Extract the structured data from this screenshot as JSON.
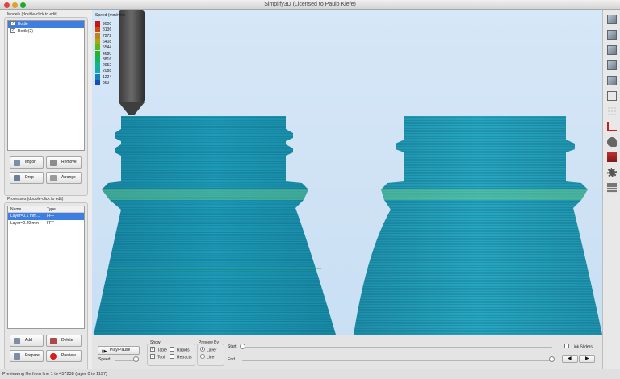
{
  "window": {
    "title": "Simplify3D (Licensed to Paulo Kiefe)"
  },
  "models": {
    "label": "Models (double-click to edit)",
    "items": [
      {
        "name": "Bottle",
        "checked": true,
        "selected": true
      },
      {
        "name": "Bottle(2)",
        "checked": true,
        "selected": false
      }
    ],
    "buttons": {
      "import": "Import",
      "remove": "Remove",
      "drop": "Drop",
      "arrange": "Arrange"
    }
  },
  "processes": {
    "label": "Processes (double-click to edit)",
    "columns": [
      "Name",
      "Type"
    ],
    "rows": [
      {
        "name": "Layer=0.1 mm...",
        "type": "FFF",
        "selected": true
      },
      {
        "name": "Layer=0.29 mm",
        "type": "FFF",
        "selected": false
      }
    ],
    "buttons": {
      "add": "Add",
      "delete": "Delete",
      "prepare": "Prepare",
      "preview": "Preview"
    }
  },
  "legend": {
    "title": "Speed (mm/min)",
    "entries": [
      {
        "value": "9000",
        "color": "#c81414"
      },
      {
        "value": "8136",
        "color": "#c84a14"
      },
      {
        "value": "7272",
        "color": "#c88214"
      },
      {
        "value": "6408",
        "color": "#a8a814"
      },
      {
        "value": "5544",
        "color": "#64b414"
      },
      {
        "value": "4680",
        "color": "#28b428"
      },
      {
        "value": "3816",
        "color": "#14b45a"
      },
      {
        "value": "2952",
        "color": "#14b48c"
      },
      {
        "value": "2088",
        "color": "#14a8b4"
      },
      {
        "value": "1224",
        "color": "#1482b4"
      },
      {
        "value": "360",
        "color": "#1450b4"
      }
    ]
  },
  "controls": {
    "play_pause": "Play/Pause",
    "speed_label": "Speed",
    "speed_level": 0.85,
    "show_label": "Show",
    "show_table": "Table",
    "show_rapids": "Rapids",
    "show_tool": "Tool",
    "show_retracts": "Retracts",
    "preview_by_label": "Preview By",
    "preview_layer": "Layer",
    "preview_line": "Line",
    "start_label": "Start",
    "end_label": "End",
    "start_level": 0.0,
    "end_level": 1.0,
    "link_sliders": "Link Sliders"
  },
  "status": {
    "text": "Previewing file from line 1 to 457238 (layer 0 to 1197)"
  },
  "toolbar_icons": [
    "view-cube-icon",
    "view-cube-icon",
    "view-cube-icon",
    "view-cube-icon",
    "view-cube-icon",
    "wireframe-cube-icon",
    "solid-view-icon",
    "axes-icon",
    "wrench-icon",
    "support-icon",
    "gear-icon",
    "layers-icon"
  ],
  "colors": {
    "accent": "#3d7ee0",
    "bottle": "#1e9cb8",
    "background": "#d0e3f5"
  }
}
